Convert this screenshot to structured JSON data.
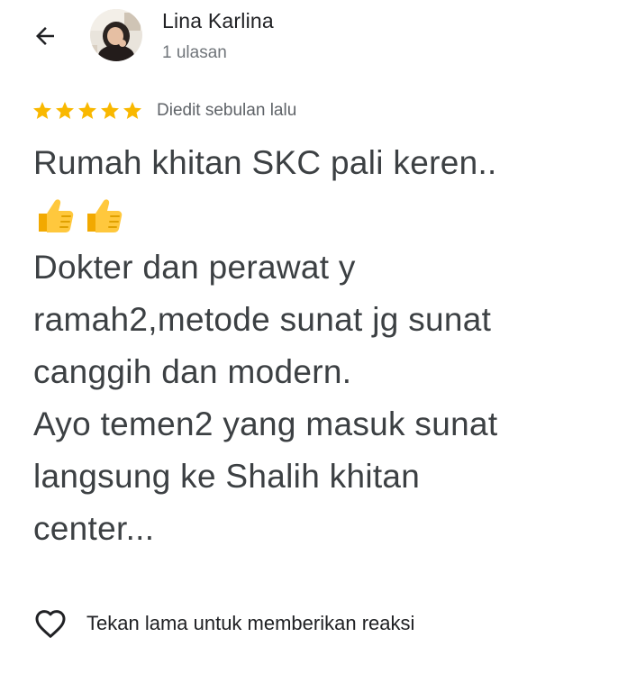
{
  "header": {
    "back_icon": "arrow-left-icon",
    "reviewer_name": "Lina Karlina",
    "review_count": "1 ulasan"
  },
  "rating": {
    "stars": 5,
    "max_stars": 5,
    "star_color": "#F9B800",
    "edited_label": "Diedit sebulan lalu"
  },
  "review": {
    "lines": [
      "Rumah khitan SKC pali keren..",
      "Dokter dan perawat y",
      "ramah2,metode sunat jg sunat",
      "canggih dan modern.",
      "Ayo temen2 yang masuk sunat",
      "langsung ke Shalih khitan",
      "center..."
    ],
    "emoji": [
      "thumbs-up-emoji",
      "thumbs-up-emoji"
    ]
  },
  "reaction": {
    "icon": "heart-outline-icon",
    "label": "Tekan lama untuk memberikan reaksi"
  }
}
